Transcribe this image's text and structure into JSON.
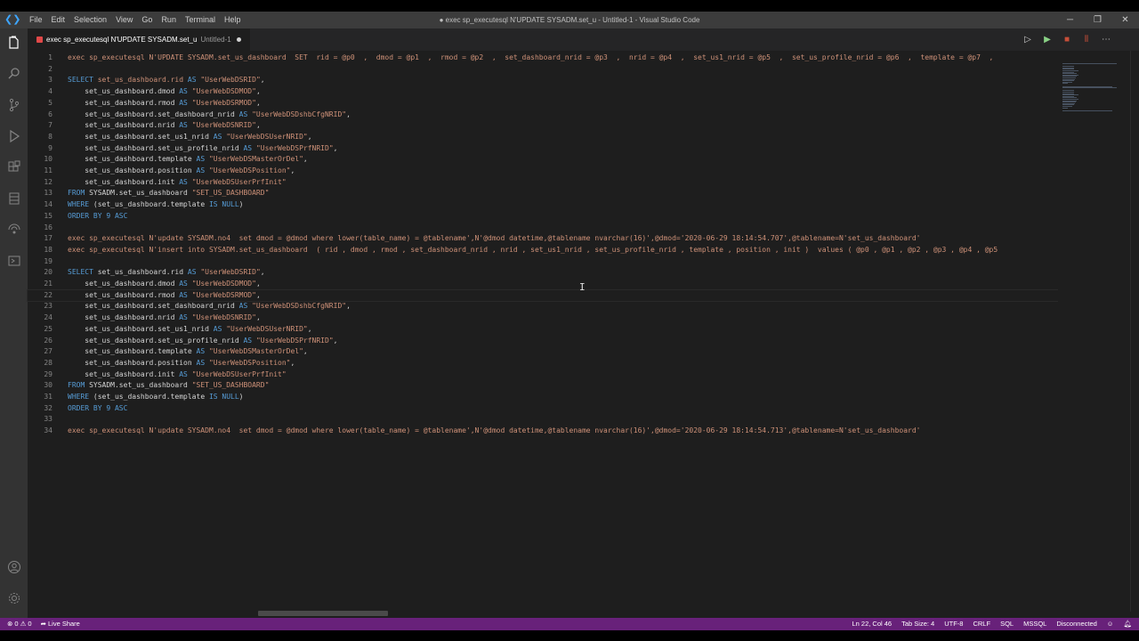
{
  "window": {
    "title": "● exec sp_executesql N'UPDATE SYSADM.set_u - Untitled-1 - Visual Studio Code",
    "menu": [
      "File",
      "Edit",
      "Selection",
      "View",
      "Go",
      "Run",
      "Terminal",
      "Help"
    ],
    "controls": {
      "minimize": "─",
      "maximize": "❐",
      "close": "✕"
    }
  },
  "activity_bar": {
    "icons": [
      "explorer-icon",
      "search-icon",
      "source-control-icon",
      "run-debug-icon",
      "extensions-icon",
      "sql-server-icon",
      "connections-icon",
      "notebook-icon"
    ],
    "bottom_icons": [
      "account-icon",
      "settings-gear-icon"
    ]
  },
  "tab": {
    "label": "exec sp_executesql N'UPDATE SYSADM.set_u",
    "file": "Untitled-1",
    "dirty": true
  },
  "editor": {
    "lines": [
      [
        {
          "t": "exec sp_executesql N'UPDATE SYSADM.set_us_dashboard  SET  rid = @p0  ,  dmod = @p1  ,  rmod = @p2  ,  set_dashboard_nrid = @p3  ,  nrid = @p4  ,  set_us1_nrid = @p5  ,  set_us_profile_nrid = @p6  ,  template = @p7  ,  ",
          "c": "str"
        }
      ],
      [],
      [
        {
          "t": "SELECT ",
          "c": "kw"
        },
        {
          "t": "set_us_dashboard.rid ",
          "c": "str"
        },
        {
          "t": "AS ",
          "c": "kw"
        },
        {
          "t": "\"UserWebDSRID\"",
          "c": "str"
        },
        {
          "t": ",",
          "c": ""
        }
      ],
      [
        {
          "t": "    set_us_dashboard.dmod ",
          "c": ""
        },
        {
          "t": "AS ",
          "c": "kw"
        },
        {
          "t": "\"UserWebDSDMOD\"",
          "c": "str"
        },
        {
          "t": ",",
          "c": ""
        }
      ],
      [
        {
          "t": "    set_us_dashboard.rmod ",
          "c": ""
        },
        {
          "t": "AS ",
          "c": "kw"
        },
        {
          "t": "\"UserWebDSRMOD\"",
          "c": "str"
        },
        {
          "t": ",",
          "c": ""
        }
      ],
      [
        {
          "t": "    set_us_dashboard.set_dashboard_nrid ",
          "c": ""
        },
        {
          "t": "AS ",
          "c": "kw"
        },
        {
          "t": "\"UserWebDSDshbCfgNRID\"",
          "c": "str"
        },
        {
          "t": ",",
          "c": ""
        }
      ],
      [
        {
          "t": "    set_us_dashboard.nrid ",
          "c": ""
        },
        {
          "t": "AS ",
          "c": "kw"
        },
        {
          "t": "\"UserWebDSNRID\"",
          "c": "str"
        },
        {
          "t": ",",
          "c": ""
        }
      ],
      [
        {
          "t": "    set_us_dashboard.set_us1_nrid ",
          "c": ""
        },
        {
          "t": "AS ",
          "c": "kw"
        },
        {
          "t": "\"UserWebDSUserNRID\"",
          "c": "str"
        },
        {
          "t": ",",
          "c": ""
        }
      ],
      [
        {
          "t": "    set_us_dashboard.set_us_profile_nrid ",
          "c": ""
        },
        {
          "t": "AS ",
          "c": "kw"
        },
        {
          "t": "\"UserWebDSPrfNRID\"",
          "c": "str"
        },
        {
          "t": ",",
          "c": ""
        }
      ],
      [
        {
          "t": "    set_us_dashboard.template ",
          "c": ""
        },
        {
          "t": "AS ",
          "c": "kw"
        },
        {
          "t": "\"UserWebDSMasterOrDel\"",
          "c": "str"
        },
        {
          "t": ",",
          "c": ""
        }
      ],
      [
        {
          "t": "    set_us_dashboard.position ",
          "c": ""
        },
        {
          "t": "AS ",
          "c": "kw"
        },
        {
          "t": "\"UserWebDSPosition\"",
          "c": "str"
        },
        {
          "t": ",",
          "c": ""
        }
      ],
      [
        {
          "t": "    set_us_dashboard.init ",
          "c": ""
        },
        {
          "t": "AS ",
          "c": "kw"
        },
        {
          "t": "\"UserWebDSUserPrfInit\"",
          "c": "str"
        }
      ],
      [
        {
          "t": "FROM ",
          "c": "kw"
        },
        {
          "t": "SYSADM.set_us_dashboard ",
          "c": ""
        },
        {
          "t": "\"SET_US_DASHBOARD\"",
          "c": "str"
        }
      ],
      [
        {
          "t": "WHERE ",
          "c": "kw"
        },
        {
          "t": "(set_us_dashboard.template ",
          "c": ""
        },
        {
          "t": "IS NULL",
          "c": "kw"
        },
        {
          "t": ")",
          "c": ""
        }
      ],
      [
        {
          "t": "ORDER BY 9 ASC",
          "c": "kw"
        }
      ],
      [],
      [
        {
          "t": "exec sp_executesql N'update SYSADM.no4  set dmod = @dmod where lower(table_name) = @tablename',N'@dmod datetime,@tablename nvarchar(16)',@dmod='2020-06-29 18:14:54.707',@tablename=N'set_us_dashboard'",
          "c": "str"
        }
      ],
      [
        {
          "t": "exec sp_executesql N'insert into SYSADM.set_us_dashboard  ( rid , dmod , rmod , set_dashboard_nrid , nrid , set_us1_nrid , set_us_profile_nrid , template , position , init )  values ( @p0 , @p1 , @p2 , @p3 , @p4 , @p5",
          "c": "str"
        }
      ],
      [],
      [
        {
          "t": "SELECT ",
          "c": "kw"
        },
        {
          "t": "set_us_dashboard.rid ",
          "c": ""
        },
        {
          "t": "AS ",
          "c": "kw"
        },
        {
          "t": "\"UserWebDSRID\"",
          "c": "str"
        },
        {
          "t": ",",
          "c": ""
        }
      ],
      [
        {
          "t": "    set_us_dashboard.dmod ",
          "c": ""
        },
        {
          "t": "AS ",
          "c": "kw"
        },
        {
          "t": "\"UserWebDSDMOD\"",
          "c": "str"
        },
        {
          "t": ",",
          "c": ""
        }
      ],
      [
        {
          "t": "    set_us_dashboard.rmod ",
          "c": ""
        },
        {
          "t": "AS ",
          "c": "kw"
        },
        {
          "t": "\"UserWebDSRMOD\"",
          "c": "str"
        },
        {
          "t": ",",
          "c": ""
        }
      ],
      [
        {
          "t": "    set_us_dashboard.set_dashboard_nrid ",
          "c": ""
        },
        {
          "t": "AS ",
          "c": "kw"
        },
        {
          "t": "\"UserWebDSDshbCfgNRID\"",
          "c": "str"
        },
        {
          "t": ",",
          "c": ""
        }
      ],
      [
        {
          "t": "    set_us_dashboard.nrid ",
          "c": ""
        },
        {
          "t": "AS ",
          "c": "kw"
        },
        {
          "t": "\"UserWebDSNRID\"",
          "c": "str"
        },
        {
          "t": ",",
          "c": ""
        }
      ],
      [
        {
          "t": "    set_us_dashboard.set_us1_nrid ",
          "c": ""
        },
        {
          "t": "AS ",
          "c": "kw"
        },
        {
          "t": "\"UserWebDSUserNRID\"",
          "c": "str"
        },
        {
          "t": ",",
          "c": ""
        }
      ],
      [
        {
          "t": "    set_us_dashboard.set_us_profile_nrid ",
          "c": ""
        },
        {
          "t": "AS ",
          "c": "kw"
        },
        {
          "t": "\"UserWebDSPrfNRID\"",
          "c": "str"
        },
        {
          "t": ",",
          "c": ""
        }
      ],
      [
        {
          "t": "    set_us_dashboard.template ",
          "c": ""
        },
        {
          "t": "AS ",
          "c": "kw"
        },
        {
          "t": "\"UserWebDSMasterOrDel\"",
          "c": "str"
        },
        {
          "t": ",",
          "c": ""
        }
      ],
      [
        {
          "t": "    set_us_dashboard.position ",
          "c": ""
        },
        {
          "t": "AS ",
          "c": "kw"
        },
        {
          "t": "\"UserWebDSPosition\"",
          "c": "str"
        },
        {
          "t": ",",
          "c": ""
        }
      ],
      [
        {
          "t": "    set_us_dashboard.init ",
          "c": ""
        },
        {
          "t": "AS ",
          "c": "kw"
        },
        {
          "t": "\"UserWebDSUserPrfInit\"",
          "c": "str"
        }
      ],
      [
        {
          "t": "FROM ",
          "c": "kw"
        },
        {
          "t": "SYSADM.set_us_dashboard ",
          "c": ""
        },
        {
          "t": "\"SET_US_DASHBOARD\"",
          "c": "str"
        }
      ],
      [
        {
          "t": "WHERE ",
          "c": "kw"
        },
        {
          "t": "(set_us_dashboard.template ",
          "c": ""
        },
        {
          "t": "IS NULL",
          "c": "kw"
        },
        {
          "t": ")",
          "c": ""
        }
      ],
      [
        {
          "t": "ORDER BY 9 ASC",
          "c": "kw"
        }
      ],
      [],
      [
        {
          "t": "exec sp_executesql N'update SYSADM.no4  set dmod = @dmod where lower(table_name) = @tablename',N'@dmod datetime,@tablename nvarchar(16)',@dmod='2020-06-29 18:14:54.713',@tablename=N'set_us_dashboard'",
          "c": "str"
        }
      ]
    ],
    "current_line": 22
  },
  "statusbar": {
    "errors": "⊗ 0 ⚠ 0",
    "liveshare": "Live Share",
    "position": "Ln 22, Col 46",
    "tab_size": "Tab Size: 4",
    "encoding": "UTF-8",
    "eol": "CRLF",
    "language": "SQL",
    "connection_type": "MSSQL",
    "connection_state": "Disconnected"
  }
}
